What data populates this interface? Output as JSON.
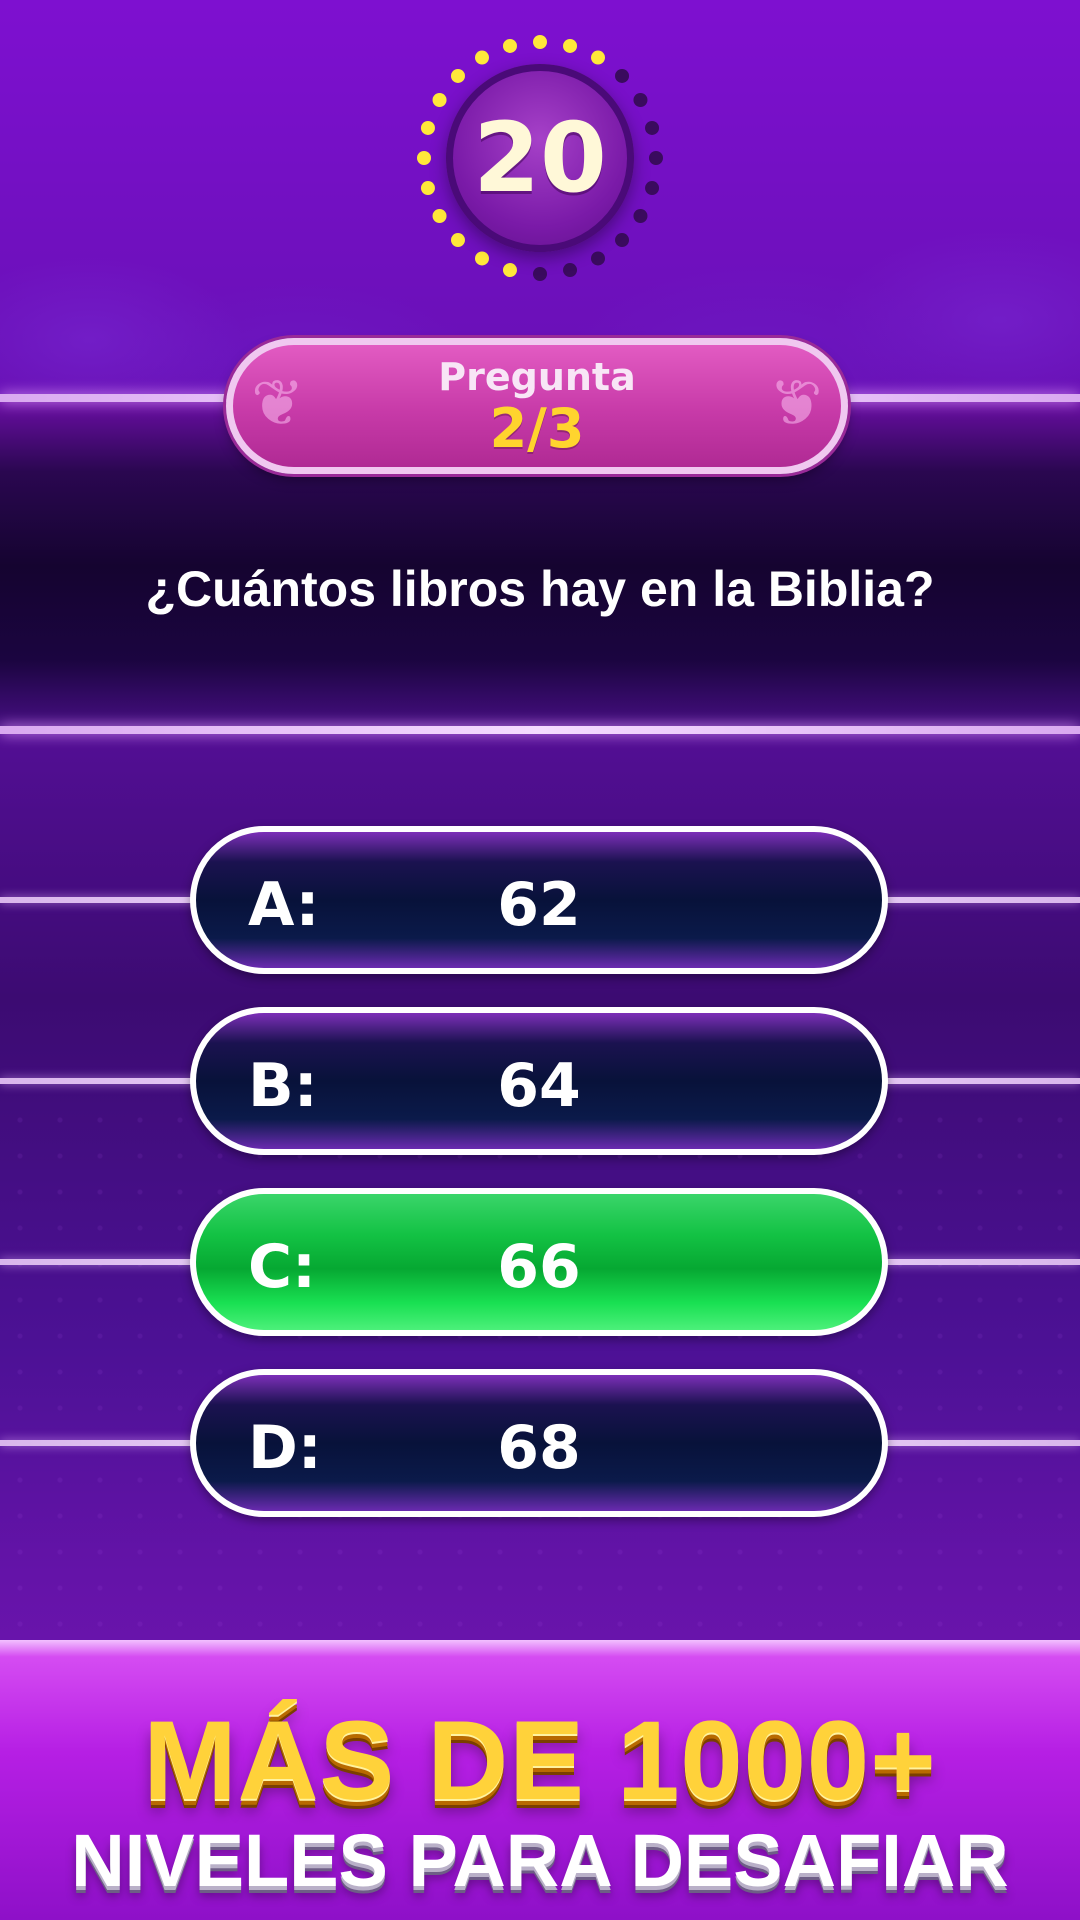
{
  "timer": {
    "value": "20",
    "remaining_fraction": 0.6,
    "colors": {
      "active": "#ffe83a",
      "spent": "#3a0b5e"
    }
  },
  "question_badge": {
    "label": "Pregunta",
    "counter": "2/3"
  },
  "question": {
    "text": "¿Cuántos libros hay en la Biblia?"
  },
  "answers": [
    {
      "letter": "A:",
      "value": "62",
      "state": "default"
    },
    {
      "letter": "B:",
      "value": "64",
      "state": "default"
    },
    {
      "letter": "C:",
      "value": "66",
      "state": "correct"
    },
    {
      "letter": "D:",
      "value": "68",
      "state": "default"
    }
  ],
  "promo": {
    "line1": "MÁS DE 1000+",
    "line2": "NIVELES PARA DESAFIAR"
  },
  "colors": {
    "correct": "#13c244",
    "accent_yellow": "#ffd23a",
    "badge_pink": "#d04ab8"
  }
}
